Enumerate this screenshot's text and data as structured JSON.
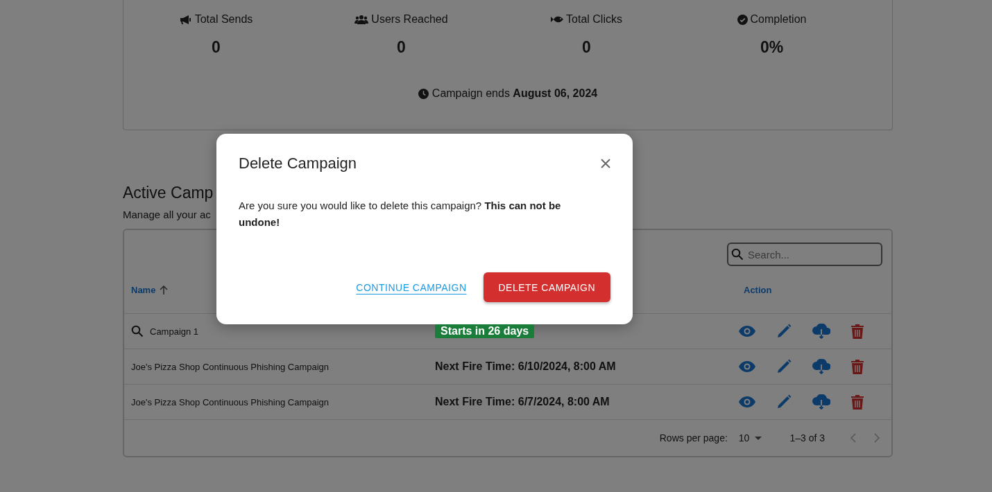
{
  "stats": [
    {
      "label": "Total Sends",
      "value": "0"
    },
    {
      "label": "Users Reached",
      "value": "0"
    },
    {
      "label": "Total Clicks",
      "value": "0"
    },
    {
      "label": "Completion",
      "value": "0%"
    }
  ],
  "campaign_end": "Campaign ends **August 06, 2024**",
  "section": {
    "title": "Active Camp",
    "subtitle": "Manage all your ac"
  },
  "table": {
    "search": {
      "placeholder": "Search..."
    },
    "columns": [
      {
        "label": "Name",
        "sorted": true
      },
      {
        "label": "Action",
        "sorted": false
      }
    ],
    "rows": [
      {
        "name": "Campaign 1",
        "search_icon": true,
        "status": {
          "kind": "badge",
          "text": "Starts in 26 days",
          "color": "#1a7d3a"
        }
      },
      {
        "name": "Joe's Pizza Shop Continuous Phishing Campaign",
        "search_icon": false,
        "status": {
          "kind": "text",
          "text": "Next Fire Time: 6/10/2024, 8:00 AM"
        }
      },
      {
        "name": "Joe's Pizza Shop Continuous Phishing Campaign",
        "search_icon": false,
        "status": {
          "kind": "text",
          "text": "Next Fire Time: 6/7/2024, 8:00 AM"
        }
      }
    ],
    "pagination": {
      "rows_per_page_label": "Rows per page:",
      "rows_per_page": "10",
      "range": "1–3 of 3",
      "prev_disabled": true,
      "next_disabled": true
    }
  },
  "dialog": {
    "title": "Delete Campaign",
    "message": "Are you sure you would like to delete this campaign? **This can not be undone!**",
    "buttons": [
      {
        "label": "CONTINUE CAMPAIGN",
        "kind": "link"
      },
      {
        "label": "DELETE CAMPAIGN",
        "kind": "danger"
      }
    ]
  }
}
